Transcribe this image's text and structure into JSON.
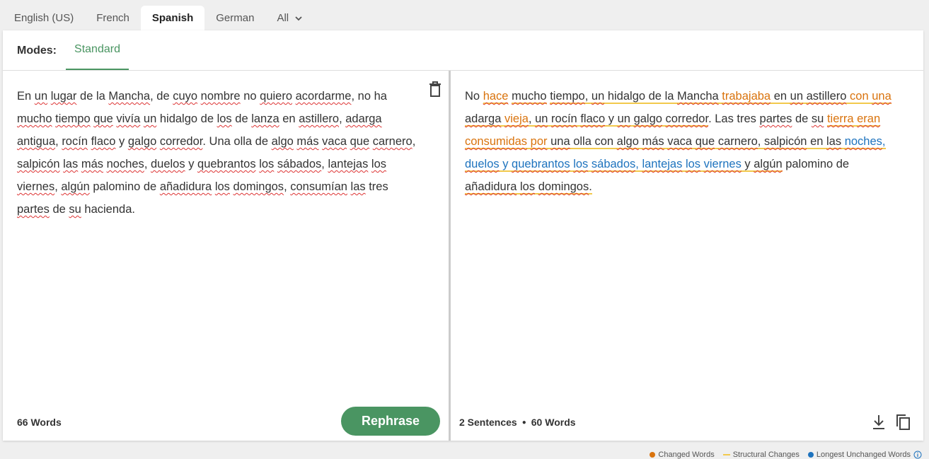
{
  "language_tabs": [
    {
      "label": "English (US)"
    },
    {
      "label": "French"
    },
    {
      "label": "Spanish"
    },
    {
      "label": "German"
    },
    {
      "label": "All"
    }
  ],
  "modes": {
    "label": "Modes:",
    "standard": "Standard"
  },
  "input": {
    "tokens": [
      [
        "En",
        0
      ],
      [
        " ",
        0
      ],
      [
        "un",
        1
      ],
      [
        " ",
        0
      ],
      [
        "lugar",
        1
      ],
      [
        " de la ",
        0
      ],
      [
        "Mancha",
        1
      ],
      [
        ", de ",
        0
      ],
      [
        "cuyo",
        1
      ],
      [
        " ",
        0
      ],
      [
        "nombre",
        1
      ],
      [
        " no ",
        0
      ],
      [
        "quiero",
        1
      ],
      [
        " ",
        0
      ],
      [
        "acordarme",
        1
      ],
      [
        ", no ha",
        0
      ],
      [
        "\n",
        0
      ],
      [
        "mucho",
        1
      ],
      [
        " ",
        0
      ],
      [
        "tiempo",
        1
      ],
      [
        " ",
        0
      ],
      [
        "que",
        1
      ],
      [
        " ",
        0
      ],
      [
        "vivía",
        1
      ],
      [
        " ",
        0
      ],
      [
        "un",
        1
      ],
      [
        " hidalgo de ",
        0
      ],
      [
        "los",
        1
      ],
      [
        " de ",
        0
      ],
      [
        "lanza",
        1
      ],
      [
        " en ",
        0
      ],
      [
        "astillero",
        1
      ],
      [
        ", ",
        0
      ],
      [
        "adarga",
        1
      ],
      [
        "\n",
        0
      ],
      [
        "antigua",
        1
      ],
      [
        ", ",
        0
      ],
      [
        "rocín",
        1
      ],
      [
        " ",
        0
      ],
      [
        "flaco",
        1
      ],
      [
        " y ",
        0
      ],
      [
        "galgo",
        1
      ],
      [
        " ",
        0
      ],
      [
        "corredor",
        1
      ],
      [
        ". Una olla de ",
        0
      ],
      [
        "algo",
        1
      ],
      [
        " ",
        0
      ],
      [
        "más",
        1
      ],
      [
        " ",
        0
      ],
      [
        "vaca",
        1
      ],
      [
        " ",
        0
      ],
      [
        "que",
        1
      ],
      [
        " ",
        0
      ],
      [
        "carnero",
        1
      ],
      [
        ",",
        0
      ],
      [
        "\n",
        0
      ],
      [
        "salpicón",
        1
      ],
      [
        " ",
        0
      ],
      [
        "las",
        1
      ],
      [
        " ",
        0
      ],
      [
        "más",
        1
      ],
      [
        " ",
        0
      ],
      [
        "noches",
        1
      ],
      [
        ", ",
        0
      ],
      [
        "duelos",
        1
      ],
      [
        " y ",
        0
      ],
      [
        "quebrantos",
        1
      ],
      [
        " ",
        0
      ],
      [
        "los",
        1
      ],
      [
        " ",
        0
      ],
      [
        "sábados",
        1
      ],
      [
        ", ",
        0
      ],
      [
        "lantejas",
        1
      ],
      [
        " ",
        0
      ],
      [
        "los",
        1
      ],
      [
        "\n",
        0
      ],
      [
        "viernes",
        1
      ],
      [
        ", ",
        0
      ],
      [
        "algún",
        1
      ],
      [
        " palomino de ",
        0
      ],
      [
        "añadidura",
        1
      ],
      [
        " ",
        0
      ],
      [
        "los",
        1
      ],
      [
        " ",
        0
      ],
      [
        "domingos",
        1
      ],
      [
        ", ",
        0
      ],
      [
        "consumían",
        1
      ],
      [
        " ",
        0
      ],
      [
        "las",
        1
      ],
      [
        " tres",
        0
      ],
      [
        "\n",
        0
      ],
      [
        "partes",
        1
      ],
      [
        " de ",
        0
      ],
      [
        "su",
        1
      ],
      [
        " hacienda.",
        0
      ]
    ],
    "word_count": "66 Words",
    "rephrase_label": "Rephrase"
  },
  "output": {
    "lines": [
      [
        [
          "No ",
          ""
        ],
        [
          "hace",
          "ch sp st"
        ],
        [
          " ",
          ""
        ],
        [
          "mucho",
          "sp st"
        ],
        [
          " ",
          ""
        ],
        [
          "tiempo",
          "sp st"
        ],
        [
          ", ",
          "st"
        ],
        [
          "un",
          "sp st"
        ],
        [
          " hidalgo de la ",
          "st"
        ],
        [
          "Mancha",
          "sp st"
        ],
        [
          " ",
          "st"
        ],
        [
          "trabajaba",
          "ch sp st"
        ],
        [
          " en ",
          "st"
        ],
        [
          "un",
          "sp st"
        ],
        [
          " ",
          "st"
        ],
        [
          "astillero",
          "sp st"
        ],
        [
          " con ",
          "ch st"
        ],
        [
          "una",
          "ch sp st"
        ]
      ],
      [
        [
          "adarga",
          "sp st"
        ],
        [
          " ",
          "st"
        ],
        [
          "vieja",
          "ch sp st"
        ],
        [
          ", ",
          "st"
        ],
        [
          "un",
          "sp st"
        ],
        [
          " ",
          "st"
        ],
        [
          "rocín",
          "sp st"
        ],
        [
          " ",
          "st"
        ],
        [
          "flaco",
          "sp st"
        ],
        [
          " y ",
          "st"
        ],
        [
          "un",
          "sp st"
        ],
        [
          " ",
          "st"
        ],
        [
          "galgo",
          "sp st"
        ],
        [
          " ",
          "st"
        ],
        [
          "corredor",
          "sp st"
        ],
        [
          ". Las tres ",
          ""
        ],
        [
          "partes",
          "sp"
        ],
        [
          " de ",
          ""
        ],
        [
          "su",
          "sp"
        ],
        [
          " ",
          ""
        ],
        [
          "tierra",
          "ch sp st"
        ],
        [
          " ",
          "st"
        ],
        [
          "eran",
          "ch sp st"
        ]
      ],
      [
        [
          "consumidas",
          "ch sp st"
        ],
        [
          " ",
          "st"
        ],
        [
          "por",
          "ch sp st"
        ],
        [
          " ",
          "st"
        ],
        [
          "una",
          "sp st"
        ],
        [
          " olla con ",
          "st"
        ],
        [
          "algo",
          "sp st"
        ],
        [
          " ",
          "st"
        ],
        [
          "más",
          "sp st"
        ],
        [
          " ",
          "st"
        ],
        [
          "vaca",
          "sp st"
        ],
        [
          " ",
          "st"
        ],
        [
          "que",
          "sp st"
        ],
        [
          " ",
          "st"
        ],
        [
          "carnero",
          "sp st"
        ],
        [
          ", ",
          "st"
        ],
        [
          "salpicón",
          "sp st"
        ],
        [
          " en ",
          "st"
        ],
        [
          "las",
          "sp st"
        ],
        [
          " ",
          "st"
        ],
        [
          "noches",
          "lu sp st"
        ],
        [
          ",",
          "lu st"
        ]
      ],
      [
        [
          "duelos",
          "lu sp st"
        ],
        [
          " y ",
          "lu st"
        ],
        [
          "quebrantos",
          "lu sp st"
        ],
        [
          " ",
          "lu st"
        ],
        [
          "los",
          "lu sp st"
        ],
        [
          " ",
          "lu st"
        ],
        [
          "sábados",
          "lu sp st"
        ],
        [
          ", ",
          "lu st"
        ],
        [
          "lantejas",
          "lu sp st"
        ],
        [
          " ",
          "lu st"
        ],
        [
          "los",
          "lu sp st"
        ],
        [
          " ",
          "lu st"
        ],
        [
          "viernes",
          "lu sp st"
        ],
        [
          " y ",
          "st"
        ],
        [
          "algún",
          "sp st"
        ],
        [
          " palomino de",
          ""
        ]
      ],
      [
        [
          "añadidura",
          "sp st"
        ],
        [
          " ",
          "st"
        ],
        [
          "los",
          "sp st"
        ],
        [
          " ",
          "st"
        ],
        [
          "domingos",
          "sp st"
        ],
        [
          ".",
          "st"
        ]
      ]
    ],
    "sentence_count": "2 Sentences",
    "word_count": "60 Words"
  },
  "legend": {
    "changed": "Changed Words",
    "structural": "Structural Changes",
    "longest": "Longest Unchanged Words"
  },
  "colors": {
    "brand": "#4a9562",
    "changed": "#d9730d",
    "structural": "#f2c94c",
    "longest": "#1e73be"
  }
}
